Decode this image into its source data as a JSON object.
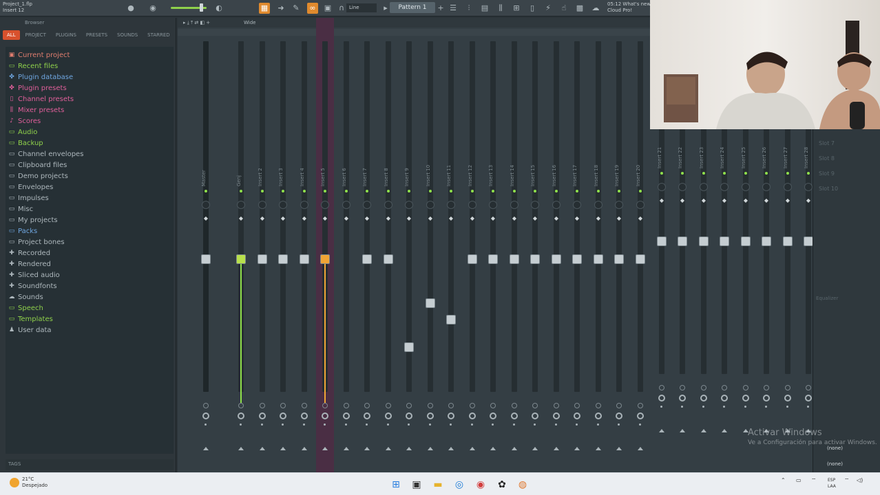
{
  "toolbar": {
    "project_title": "Project_1.flp",
    "insert_label": "Insert 12",
    "line_mode": "Line",
    "pattern": "Pattern 1",
    "news_line1": "05:12 What's new",
    "news_line2": "Cloud Pro!"
  },
  "browser": {
    "title": "Browser",
    "tabs": [
      "ALL",
      "PROJECT",
      "PLUGINS",
      "PRESETS",
      "SOUNDS",
      "STARRED"
    ],
    "items": [
      {
        "label": "Current project",
        "icon": "project-icon",
        "color": "#e07d6f"
      },
      {
        "label": "Recent files",
        "icon": "folder-icon",
        "color": "#8fd14b"
      },
      {
        "label": "Plugin database",
        "icon": "plugin-icon",
        "color": "#6fa6e0"
      },
      {
        "label": "Plugin presets",
        "icon": "plugin-icon",
        "color": "#e05f9a"
      },
      {
        "label": "Channel presets",
        "icon": "channel-icon",
        "color": "#e05f9a"
      },
      {
        "label": "Mixer presets",
        "icon": "mixer-icon",
        "color": "#e05f9a"
      },
      {
        "label": "Scores",
        "icon": "note-icon",
        "color": "#e05f9a"
      },
      {
        "label": "Audio",
        "icon": "folder-icon",
        "color": "#8fd14b"
      },
      {
        "label": "Backup",
        "icon": "folder-icon",
        "color": "#8fd14b"
      },
      {
        "label": "Channel envelopes",
        "icon": "folder-icon",
        "color": "#aeb8bd"
      },
      {
        "label": "Clipboard files",
        "icon": "folder-icon",
        "color": "#aeb8bd"
      },
      {
        "label": "Demo projects",
        "icon": "folder-icon",
        "color": "#aeb8bd"
      },
      {
        "label": "Envelopes",
        "icon": "folder-icon",
        "color": "#aeb8bd"
      },
      {
        "label": "Impulses",
        "icon": "folder-icon",
        "color": "#aeb8bd"
      },
      {
        "label": "Misc",
        "icon": "folder-icon",
        "color": "#aeb8bd"
      },
      {
        "label": "My projects",
        "icon": "folder-icon",
        "color": "#aeb8bd"
      },
      {
        "label": "Packs",
        "icon": "folder-icon",
        "color": "#6fa6e0"
      },
      {
        "label": "Project bones",
        "icon": "folder-icon",
        "color": "#aeb8bd"
      },
      {
        "label": "Recorded",
        "icon": "plus-icon",
        "color": "#aeb8bd"
      },
      {
        "label": "Rendered",
        "icon": "plus-icon",
        "color": "#aeb8bd"
      },
      {
        "label": "Sliced audio",
        "icon": "plus-icon",
        "color": "#aeb8bd"
      },
      {
        "label": "Soundfonts",
        "icon": "plus-icon",
        "color": "#aeb8bd"
      },
      {
        "label": "Sounds",
        "icon": "cloud-icon",
        "color": "#aeb8bd"
      },
      {
        "label": "Speech",
        "icon": "speech-icon",
        "color": "#8fd14b"
      },
      {
        "label": "Templates",
        "icon": "folder-icon",
        "color": "#8fd14b"
      },
      {
        "label": "User data",
        "icon": "user-icon",
        "color": "#aeb8bd"
      }
    ],
    "tags_label": "TAGS"
  },
  "mixer": {
    "mode": "Wide",
    "master_label": "Master",
    "strips": [
      "Genj",
      "Insert 2",
      "Insert 3",
      "Insert 4",
      "Insert 5",
      "Insert 6",
      "Insert 7",
      "Insert 8",
      "Insert 9",
      "Insert 10",
      "Insert 11",
      "Insert 12",
      "Insert 13",
      "Insert 14",
      "Insert 15",
      "Insert 16",
      "Insert 17",
      "Insert 18",
      "Insert 19",
      "Insert 20",
      "Insert 21",
      "Insert 22",
      "Insert 23",
      "Insert 24",
      "Insert 25",
      "Insert 26",
      "Insert 27",
      "Insert 28"
    ],
    "slots": [
      "Slot 7",
      "Slot 8",
      "Slot 9",
      "Slot 10"
    ],
    "equalizer_label": "Equalizer",
    "route_none_1": "(none)",
    "route_none_2": "(none)"
  },
  "watermark": {
    "line1": "Activar Windows",
    "line2": "Ve a Configuración para activar Windows."
  },
  "taskbar": {
    "temp": "21°C",
    "weather": "Despejado",
    "lang1": "ESP",
    "lang2": "LAA"
  },
  "colors": {
    "accent_green": "#8fe04b",
    "accent_orange": "#f0a535",
    "browser_active_tab": "#d8512d"
  }
}
